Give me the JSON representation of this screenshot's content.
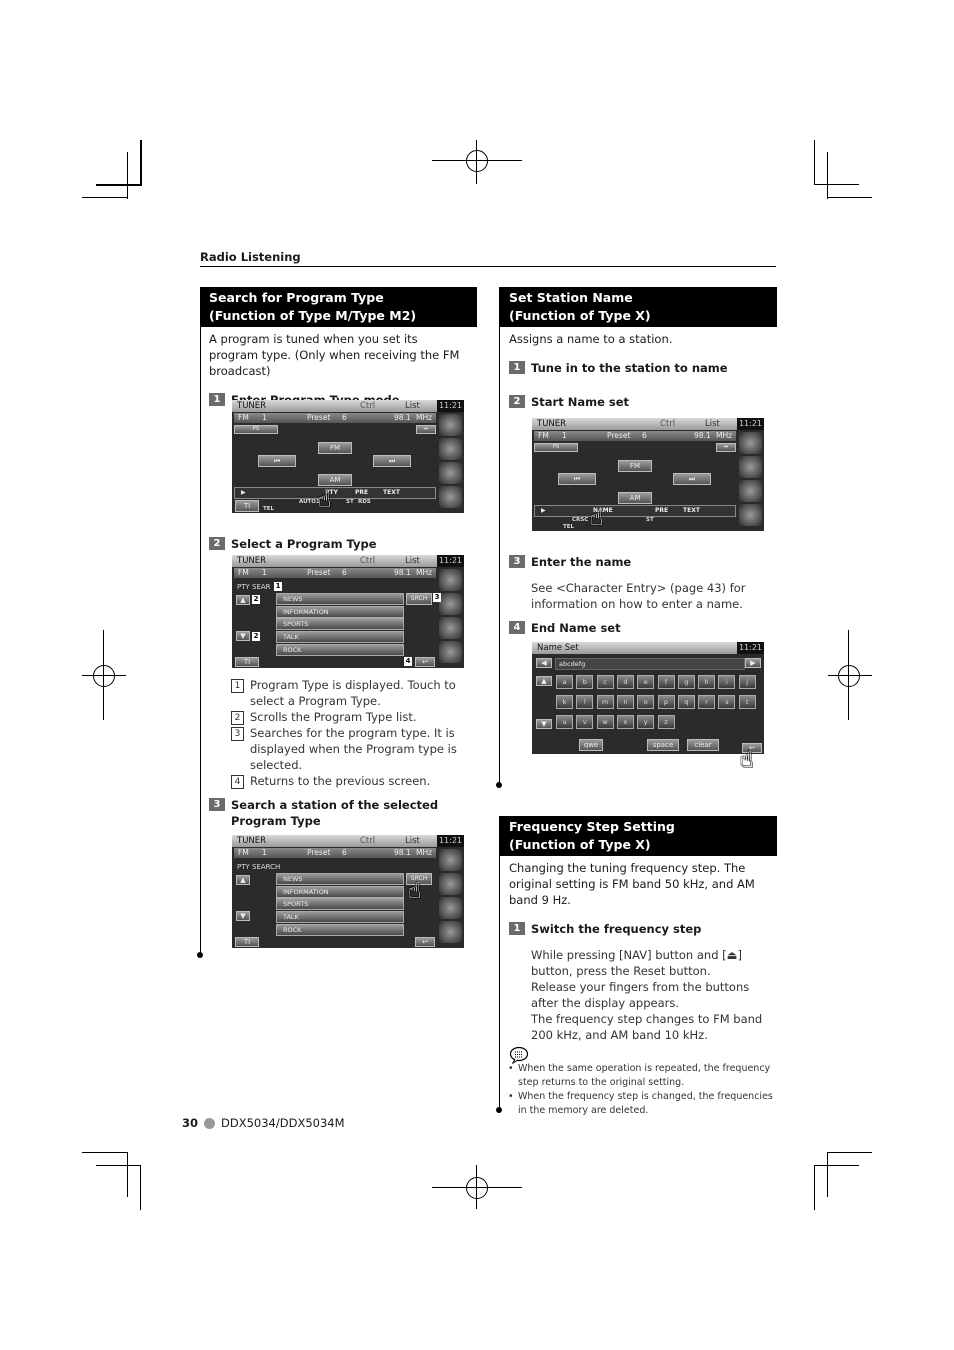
{
  "running_header": "Radio Listening",
  "left_column": {
    "section": {
      "title_line1": "Search for Program Type",
      "title_line2": "(Function of Type M/Type M2)",
      "intro": "A program is tuned when you set its program type. (Only when receiving the FM broadcast)"
    },
    "steps": [
      {
        "num": "1",
        "label": "Enter Program Type mode"
      },
      {
        "num": "2",
        "label": "Select a Program Type"
      },
      {
        "num": "3",
        "label": "Search a station of the selected Program Type"
      }
    ],
    "callouts": [
      {
        "num": "1",
        "text": "Program Type is displayed. Touch to select a Program Type."
      },
      {
        "num": "2",
        "text": "Scrolls the Program Type list."
      },
      {
        "num": "3",
        "text": "Searches for the program type. It is displayed when the Program type is selected."
      },
      {
        "num": "4",
        "text": "Returns to the previous screen."
      }
    ]
  },
  "right_column": {
    "section1": {
      "title_line1": "Set Station Name",
      "title_line2": "(Function of Type X)",
      "intro": "Assigns a name to a station."
    },
    "steps1": [
      {
        "num": "1",
        "label": "Tune in to the station to name"
      },
      {
        "num": "2",
        "label": "Start Name set"
      },
      {
        "num": "3",
        "label": "Enter the name"
      },
      {
        "num": "4",
        "label": "End Name set"
      }
    ],
    "step3_desc": "See <Character Entry> (page 43) for information on how to enter a name.",
    "section2": {
      "title_line1": "Frequency Step Setting",
      "title_line2": "(Function of Type X)",
      "intro": "Changing the tuning frequency step. The original setting is FM band 50 kHz, and AM band 9 Hz."
    },
    "steps2": [
      {
        "num": "1",
        "label": "Switch the frequency step"
      }
    ],
    "step_desc_lines": [
      "While pressing [NAV] button and [⏏] button, press the Reset button.",
      "Release your fingers from the buttons after the display appears.",
      "The frequency step changes to FM band 200 kHz, and AM band 10 kHz."
    ],
    "notes": [
      "When the same operation is repeated, the frequency step returns to the original setting.",
      "When the frequency step is changed, the frequencies in the memory are deleted."
    ]
  },
  "tuner_screen": {
    "title": "TUNER",
    "tab_ctrl": "Ctrl",
    "tab_list": "List",
    "clock": "11:21",
    "band": "FM",
    "band_num": "1",
    "preset_label": "Preset",
    "preset_num": "6",
    "frequency": "98.1",
    "unit": "MHz",
    "ps": "PS",
    "fm_btn": "FM",
    "am_btn": "AM",
    "seek_prev": "⏮",
    "seek_next": "⏭",
    "play": "▶",
    "pty": "PTY",
    "name": "NAME",
    "pre": "PRE",
    "text": "TEXT",
    "ti": "TI",
    "tel": "TEL",
    "auto1": "AUTO1",
    "crsc": "CRSC",
    "st": "ST",
    "rds": "RDS"
  },
  "pty_screen": {
    "title_short": "PTY SEAR",
    "title_full": "PTY SEARCH",
    "srch": "SRCH",
    "items": [
      "NEWS",
      "INFORMATION",
      "SPORTS",
      "TALK",
      "ROCK"
    ],
    "up": "▲",
    "down": "▼",
    "back": "↩",
    "markers": [
      "1",
      "2",
      "2",
      "3",
      "4"
    ]
  },
  "name_set_screen": {
    "title": "Name Set",
    "clock": "11:21",
    "value": "abcdefg",
    "row1": [
      "a",
      "b",
      "c",
      "d",
      "e",
      "f",
      "g",
      "h",
      "i",
      "j"
    ],
    "row2": [
      "k",
      "l",
      "m",
      "n",
      "o",
      "p",
      "q",
      "r",
      "s",
      "t"
    ],
    "row3": [
      "u",
      "v",
      "w",
      "x",
      "y",
      "z"
    ],
    "qwe": "qwe",
    "space": "space",
    "clear": "clear",
    "left": "◀",
    "right": "▶",
    "up": "▲",
    "down": "▼",
    "enter": "↩"
  },
  "footer": {
    "page": "30",
    "model": "DDX5034/DDX5034M"
  }
}
